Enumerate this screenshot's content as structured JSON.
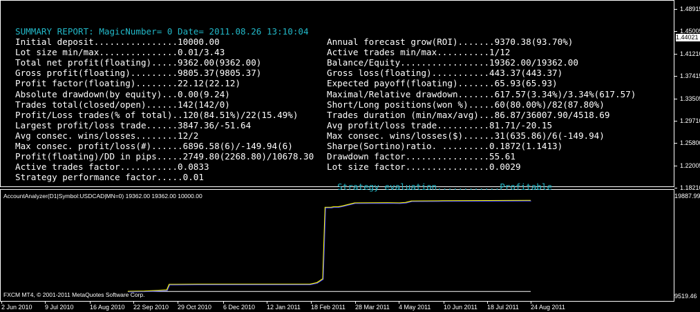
{
  "report": {
    "title": "SUMMARY REPORT: MagicNumber= 0 Date= 2011.08.26 13:10:04",
    "left_rows": [
      "Initial deposit................10000.00",
      "Lot size min/max...............0.01/3.43",
      "Total net profit(floating).....9362.00(9362.00)",
      "Gross profit(floating).........9805.37(9805.37)",
      "Profit factor(floating)........22.12(22.12)",
      "Absolute drawdown(by equity)...0.00(9.24)",
      "Trades total(closed/open)......142(142/0)",
      "Profit/Loss trades(% of total)..120(84.51%)/22(15.49%)",
      "Largest profit/loss trade......3847.36/-51.64",
      "Avg consec. wins/losses........12/2",
      "Max consec. profit/loss(#)......6896.58(6)/-149.94(6)",
      "Profit(floating)/DD in pips.....2749.80(2268.80)/10678.30",
      "Active trades factor...........0.0833",
      "Strategy performance factor.....0.01"
    ],
    "right_rows": [
      "Annual forecast grow(ROI).......9370.38(93.70%)",
      "Active trades min/max..........1/12",
      "Balance/Equity.................19362.00/19362.00",
      "Gross loss(floating)...........443.37(443.37)",
      "Expected payoff(floating).......65.93(65.93)",
      "Maximal/Relative drawdown.......617.57(3.34%)/3.34%(617.57)",
      "Short/Long positions(won %).....60(80.00%)/82(87.80%)",
      "Trades duration (min/max/avg)...86.87/36007.90/4518.69",
      "Avg profit/loss trade..........81.71/-20.15",
      "Max consec. wins/losses($)......31(635.86)/6(-149.94)",
      "Sharpe(Sortino)ratio. .........0.1872(1.1413)",
      "Drawdown factor................55.61",
      "Lot size factor................0.0029"
    ],
    "evaluation_label": "Strategy evaluation............",
    "evaluation_value": "Profitable"
  },
  "price_scale": [
    "1.48915",
    "1.45005",
    "1.41210",
    "1.37415",
    "1.33505",
    "1.29710",
    "1.25800",
    "1.22005",
    "1.18210"
  ],
  "current_price": "1.44021",
  "indicator": {
    "label": "AccountAnalyzer(D1|Symbol:USDCAD|MN=0) 19362.00 19362.00 10000.00",
    "scale_top": "19887.99",
    "scale_bottom": "9519.46",
    "copyright": "FXCM MT4, © 2001-2011 MetaQuotes Software Corp."
  },
  "dates": [
    "2 Jun 2010",
    "9 Jul 2010",
    "16 Aug 2010",
    "22 Sep 2010",
    "29 Oct 2010",
    "6 Dec 2010",
    "12 Jan 2011",
    "18 Feb 2011",
    "28 Mar 2011",
    "4 May 2011",
    "10 Jun 2011",
    "18 Jul 2011",
    "24 Aug 2011"
  ],
  "chart_data": {
    "type": "line",
    "ylim": [
      9519.46,
      19887.99
    ],
    "x": [
      "2010-09-17",
      "2010-10-01",
      "2010-10-20",
      "2010-10-22",
      "2010-11-15",
      "2010-12-15",
      "2011-01-15",
      "2011-02-18",
      "2011-02-24",
      "2011-03-01",
      "2011-03-03",
      "2011-03-08",
      "2011-03-10",
      "2011-03-14",
      "2011-03-18",
      "2011-03-28",
      "2011-04-10",
      "2011-04-25",
      "2011-05-05",
      "2011-05-10",
      "2011-05-15",
      "2011-06-10",
      "2011-07-18",
      "2011-08-24"
    ],
    "series": [
      {
        "color": "#ffff00",
        "values": [
          10000,
          10030,
          10150,
          10720,
          10740,
          10740,
          10740,
          10740,
          10900,
          11300,
          18650,
          18650,
          18700,
          18700,
          18800,
          19100,
          19110,
          19120,
          19100,
          19150,
          19300,
          19320,
          19340,
          19362
        ]
      },
      {
        "color": "#4040ff",
        "values": [
          10000,
          10030,
          10150,
          10720,
          10740,
          10740,
          10740,
          10740,
          10900,
          11300,
          18650,
          18650,
          18700,
          18700,
          18800,
          19100,
          19110,
          19120,
          19100,
          19150,
          19300,
          19320,
          19340,
          19362
        ]
      }
    ],
    "baseline": 10000,
    "baseline_color": "#ffffff"
  }
}
